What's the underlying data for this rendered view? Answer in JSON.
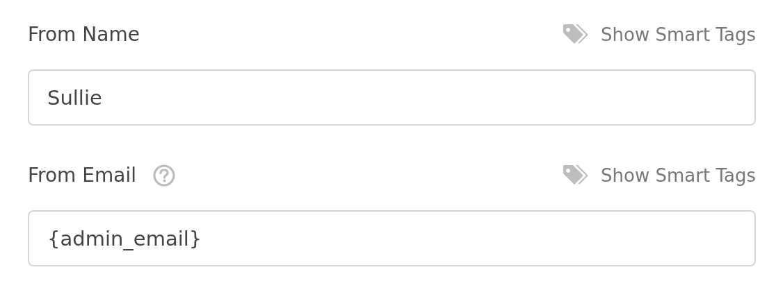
{
  "fields": [
    {
      "label": "From Name",
      "help": false,
      "smart_tags": "Show Smart Tags",
      "value": "Sullie"
    },
    {
      "label": "From Email",
      "help": true,
      "smart_tags": "Show Smart Tags",
      "value": "{admin_email}"
    }
  ]
}
